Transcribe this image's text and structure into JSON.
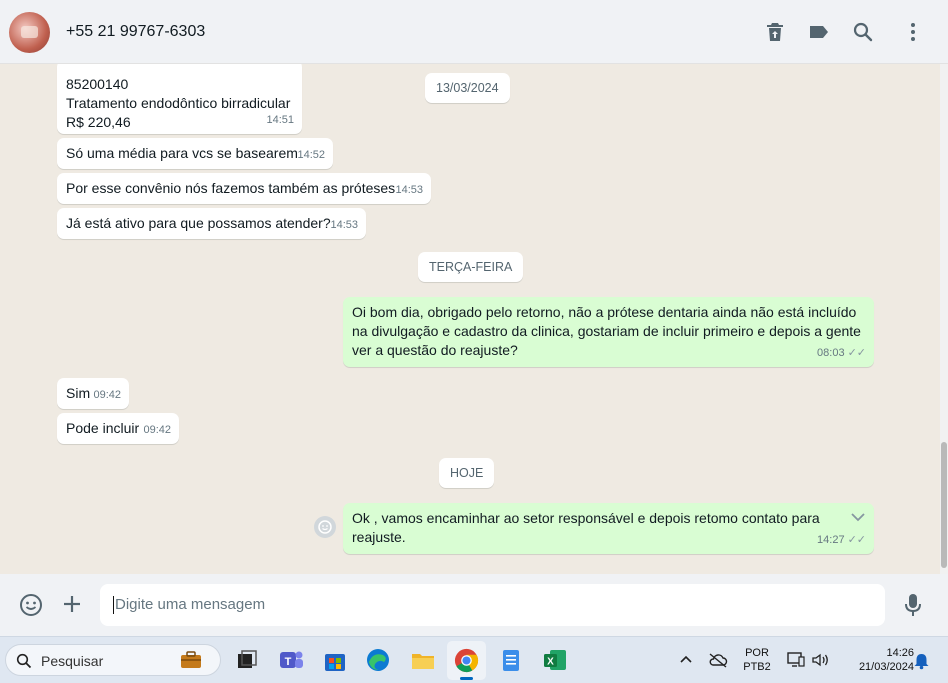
{
  "header": {
    "contact": "+55 21 99767-6303",
    "icons": [
      "archive-icon",
      "label-icon",
      "search-icon",
      "menu-icon"
    ]
  },
  "messages": {
    "m1_line1": "85200140",
    "m1_line2": "Tratamento endodôntico birradicular",
    "m1_line3": "R$ 220,46",
    "m1_time": "14:51",
    "date1": "13/03/2024",
    "m2_text": "Só uma média para vcs se basearem",
    "m2_time": "14:52",
    "m3_text": "Por esse convênio nós fazemos também as próteses",
    "m3_time": "14:53",
    "m4_text": "Já está ativo para que possamos atender?",
    "m4_time": "14:53",
    "date2": "TERÇA-FEIRA",
    "m5_line1": "Oi bom dia, obrigado pelo retorno, não a prótese dentaria ainda não está incluído",
    "m5_line2": "na divulgação e cadastro da clinica, gostariam de incluir primeiro e depois a gente",
    "m5_line3": "ver a questão do reajuste?",
    "m5_time": "08:03",
    "m6_text": "Sim",
    "m6_time": "09:42",
    "m7_text": "Pode incluir",
    "m7_time": "09:42",
    "date3": "HOJE",
    "m8_line1": "Ok , vamos encaminhar ao setor responsável e depois retomo contato para",
    "m8_line2": "reajuste.",
    "m8_time": "14:27"
  },
  "composer": {
    "placeholder": "Digite uma mensagem"
  },
  "taskbar": {
    "search_label": "Pesquisar",
    "lang_line1": "POR",
    "lang_line2": "PTB2",
    "clock_time": "14:26",
    "clock_date": "21/03/2024"
  },
  "colors": {
    "outgoing_bubble": "#d9fdd3",
    "incoming_bubble": "#ffffff",
    "chat_background": "#efeae2"
  }
}
